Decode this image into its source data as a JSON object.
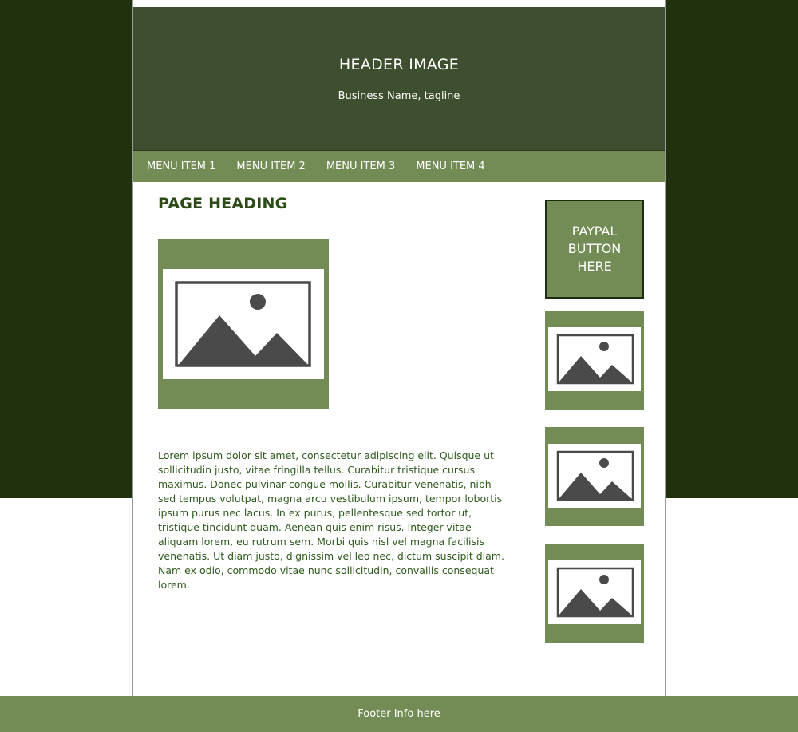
{
  "header": {
    "title": "HEADER IMAGE",
    "tagline": "Business Name, tagline"
  },
  "nav": {
    "items": [
      "MENU ITEM 1",
      "MENU ITEM 2",
      "MENU ITEM 3",
      "MENU ITEM 4"
    ]
  },
  "main": {
    "heading": "PAGE HEADING",
    "image_icon": "image-placeholder-icon",
    "body_text": "Lorem ipsum dolor sit amet, consectetur adipiscing elit. Quisque ut sollicitudin justo, vitae fringilla tellus. Curabitur tristique cursus maximus. Donec pulvinar congue mollis. Curabitur venenatis, nibh sed tempus volutpat, magna arcu vestibulum ipsum, tempor lobortis ipsum purus nec lacus. In ex purus, pellentesque sed tortor ut, tristique tincidunt quam. Aenean quis enim risus. Integer vitae aliquam lorem, eu rutrum sem. Morbi quis nisl vel magna facilisis venenatis. Ut diam justo, dignissim vel leo nec, dictum suscipit diam. Nam ex odio, commodo vitae nunc sollicitudin, convallis consequat lorem."
  },
  "sidebar": {
    "paypal_label": "PAYPAL BUTTON HERE",
    "image_icon": "image-placeholder-icon"
  },
  "footer": {
    "text": "Footer Info here"
  },
  "colors": {
    "background_dark": "#20310d",
    "header": "#3d4f2f",
    "accent": "#738b54",
    "heading_text": "#2b4a16",
    "body_text": "#2e5a1c",
    "icon_gray": "#4a4a4a"
  }
}
